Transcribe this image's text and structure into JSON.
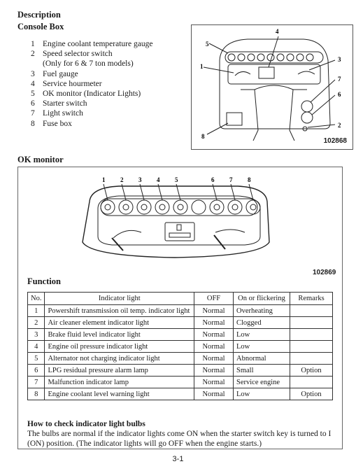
{
  "heading": "Description",
  "console_box": {
    "title": "Console Box",
    "items": [
      {
        "no": "1",
        "label": "Engine coolant temperature gauge"
      },
      {
        "no": "2",
        "label": "Speed selector switch"
      },
      {
        "no": "",
        "label": "(Only for 6 & 7 ton models)"
      },
      {
        "no": "3",
        "label": "Fuel gauge"
      },
      {
        "no": "4",
        "label": "Service hourmeter"
      },
      {
        "no": "5",
        "label": "OK monitor (Indicator Lights)"
      },
      {
        "no": "6",
        "label": "Starter switch"
      },
      {
        "no": "7",
        "label": "Light switch"
      },
      {
        "no": "8",
        "label": "Fuse box"
      }
    ],
    "figure": {
      "id": "102868",
      "callouts": [
        "1",
        "2",
        "3",
        "4",
        "5",
        "6",
        "7",
        "8"
      ]
    }
  },
  "ok_monitor": {
    "title": "OK monitor",
    "figure": {
      "id": "102869",
      "callouts": [
        "1",
        "2",
        "3",
        "4",
        "5",
        "6",
        "7",
        "8"
      ],
      "icons": [
        "transmission-oil-temp-icon",
        "air-cleaner-icon",
        "brake-fluid-icon",
        "oil-pressure-icon",
        "battery-icon",
        "blank-lamp",
        "lpg-pressure-icon",
        "warning-triangle-icon",
        "coolant-level-icon"
      ]
    }
  },
  "function": {
    "title": "Function",
    "columns": [
      "No.",
      "Indicator light",
      "OFF",
      "On or flickering",
      "Remarks"
    ],
    "rows": [
      {
        "no": "1",
        "light": "Powershift transmission oil temp. indicator light",
        "off": "Normal",
        "on": "Overheating",
        "remarks": ""
      },
      {
        "no": "2",
        "light": "Air cleaner element indicator light",
        "off": "Normal",
        "on": "Clogged",
        "remarks": ""
      },
      {
        "no": "3",
        "light": "Brake fluid level indicator light",
        "off": "Normal",
        "on": "Low",
        "remarks": ""
      },
      {
        "no": "4",
        "light": "Engine oil pressure indicator light",
        "off": "Normal",
        "on": "Low",
        "remarks": ""
      },
      {
        "no": "5",
        "light": "Alternator not charging indicator light",
        "off": "Normal",
        "on": "Abnormal",
        "remarks": ""
      },
      {
        "no": "6",
        "light": "LPG residual pressure alarm lamp",
        "off": "Normal",
        "on": "Small",
        "remarks": "Option"
      },
      {
        "no": "7",
        "light": "Malfunction indicator lamp",
        "off": "Normal",
        "on": "Service engine",
        "remarks": ""
      },
      {
        "no": "8",
        "light": "Engine coolant level warning light",
        "off": "Normal",
        "on": "Low",
        "remarks": "Option"
      }
    ]
  },
  "bulb_check": {
    "title": "How to check indicator light bulbs",
    "line1": "The bulbs are normal if the indicator lights come ON when the starter switch key is turned to I",
    "line2": "(ON) position.  (The indicator lights will go OFF when the engine starts.)"
  },
  "page_number": "3-1"
}
